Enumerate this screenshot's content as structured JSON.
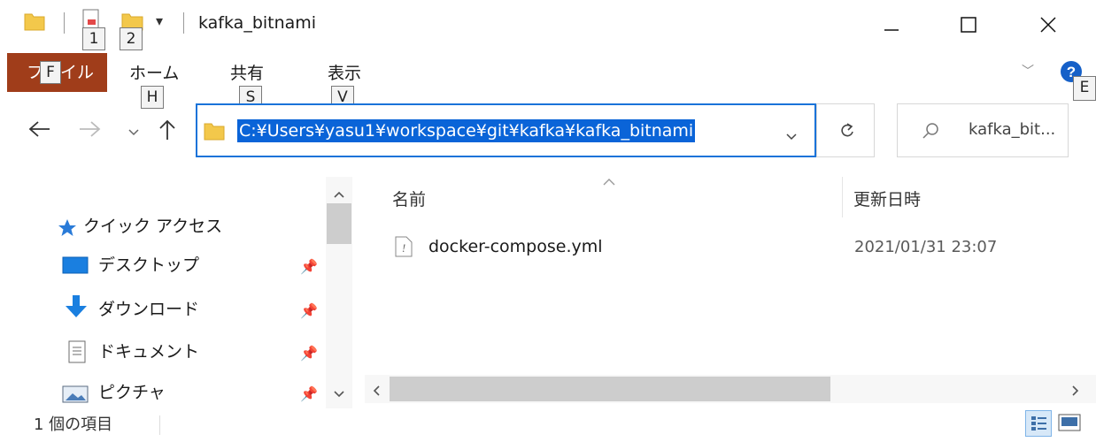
{
  "window": {
    "title": "kafka_bitnami",
    "keytips_qa": [
      "1",
      "2"
    ]
  },
  "ribbon": {
    "file_tab": "ファイル",
    "file_tab_keytip": "F",
    "tabs": [
      {
        "label": "ホーム",
        "keytip": "H"
      },
      {
        "label": "共有",
        "keytip": "S"
      },
      {
        "label": "表示",
        "keytip": "V"
      }
    ],
    "help_keytip": "E"
  },
  "address": {
    "path": "C:¥Users¥yasu1¥workspace¥git¥kafka¥kafka_bitnami",
    "search_placeholder": "kafka_bit..."
  },
  "nav_pane": {
    "quick_access": "クイック アクセス",
    "items": [
      {
        "label": "デスクトップ",
        "icon": "desktop-icon"
      },
      {
        "label": "ダウンロード",
        "icon": "download-icon"
      },
      {
        "label": "ドキュメント",
        "icon": "documents-icon"
      },
      {
        "label": "ピクチャ",
        "icon": "pictures-icon"
      }
    ]
  },
  "content": {
    "columns": {
      "name": "名前",
      "modified": "更新日時"
    },
    "files": [
      {
        "name": "docker-compose.yml",
        "modified": "2021/01/31 23:07"
      }
    ]
  },
  "status_bar": {
    "item_count": "1 個の項目"
  },
  "colors": {
    "file_tab": "#a03d1a",
    "selection": "#0a64d8",
    "address_border": "#1a73d9",
    "folder": "#f3c84b"
  }
}
